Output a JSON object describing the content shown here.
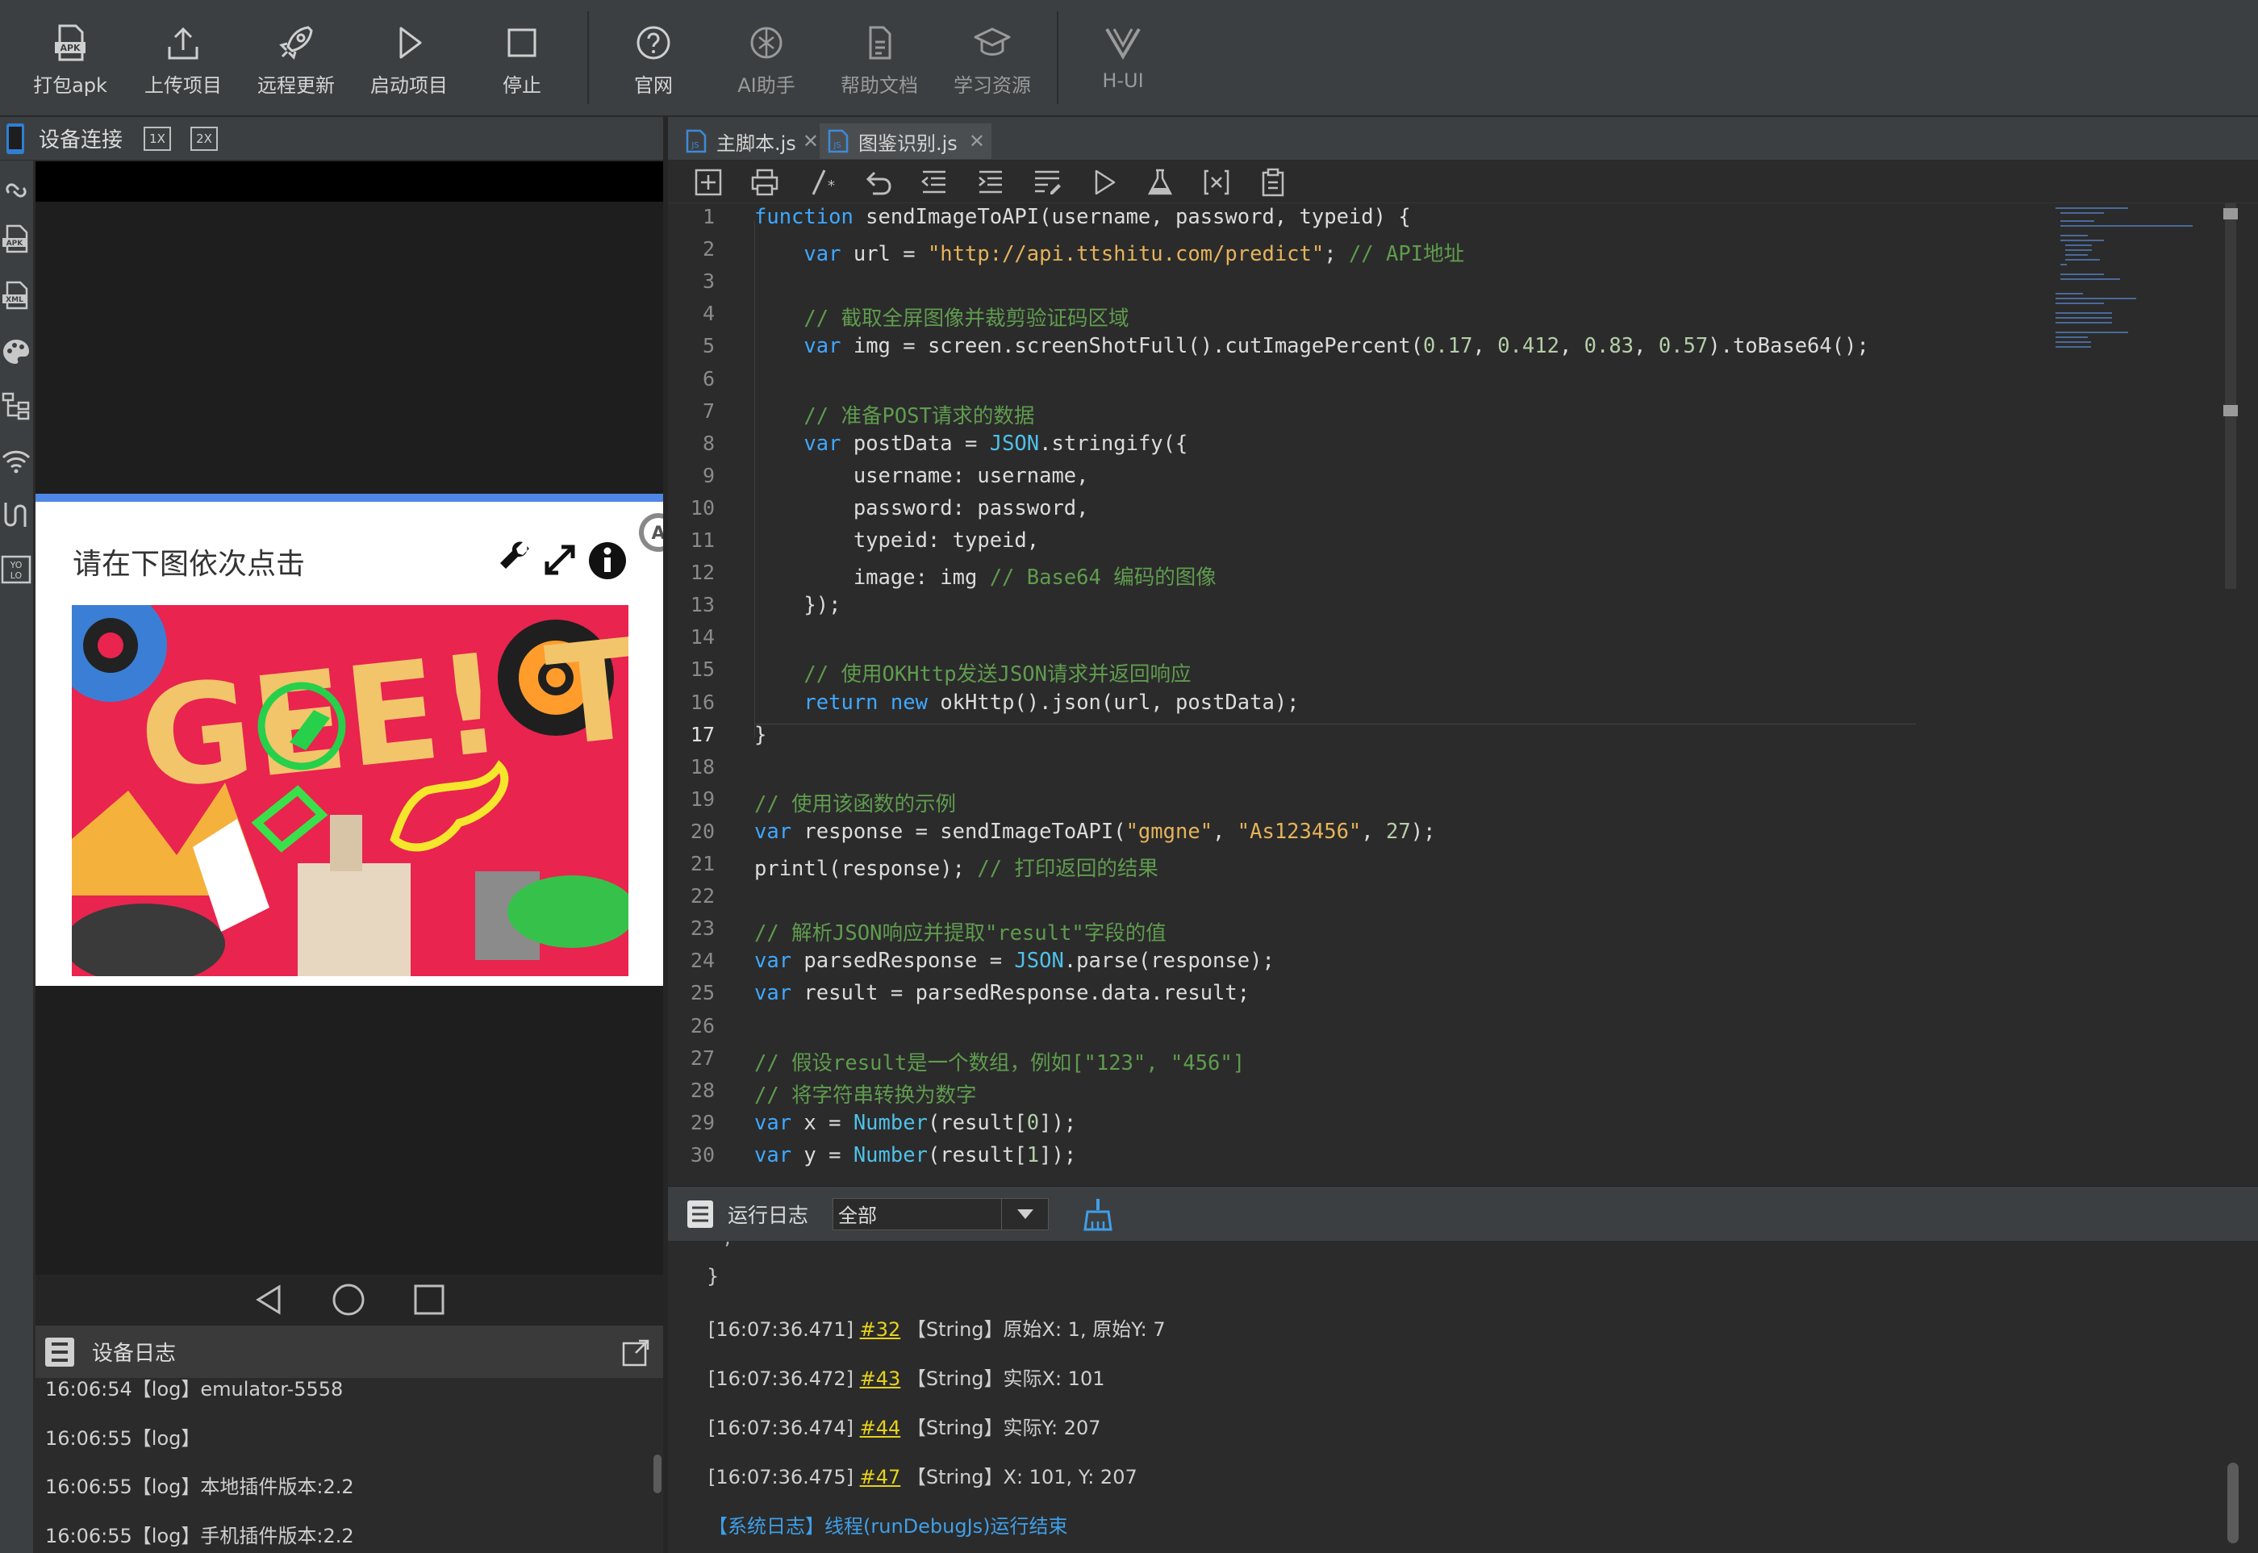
{
  "toolbar": {
    "items": [
      {
        "label": "打包apk",
        "icon": "apk-icon"
      },
      {
        "label": "上传项目",
        "icon": "upload-icon"
      },
      {
        "label": "远程更新",
        "icon": "rocket-icon"
      },
      {
        "label": "启动项目",
        "icon": "play-icon"
      },
      {
        "label": "停止",
        "icon": "stop-icon"
      },
      {
        "label": "官网",
        "icon": "help-circle-icon"
      },
      {
        "label": "AI助手",
        "icon": "ai-icon"
      },
      {
        "label": "帮助文档",
        "icon": "document-icon"
      },
      {
        "label": "学习资源",
        "icon": "graduation-cap-icon"
      },
      {
        "label": "H-UI",
        "icon": "hui-logo-icon"
      }
    ]
  },
  "device_panel": {
    "title": "设备连接",
    "zoom_1x": "1X",
    "zoom_2x": "2X",
    "captcha": {
      "prompt": "请在下图依次点击",
      "image_text": "GEE! TEST"
    },
    "device_log": {
      "title": "设备日志",
      "lines": [
        "16:06:54【log】emulator-5558",
        "16:06:55【log】",
        "16:06:55【log】本地插件版本:2.2",
        "16:06:55【log】手机插件版本:2.2"
      ]
    }
  },
  "tabs": [
    {
      "label": "主脚本.js"
    },
    {
      "label": "图鉴识别.js"
    }
  ],
  "editor": {
    "line_numbers": [
      "1",
      "2",
      "3",
      "4",
      "5",
      "6",
      "7",
      "8",
      "9",
      "10",
      "11",
      "12",
      "13",
      "14",
      "15",
      "16",
      "17",
      "18",
      "19",
      "20",
      "21",
      "22",
      "23",
      "24",
      "25",
      "26",
      "27",
      "28",
      "29",
      "30"
    ],
    "code": [
      "function sendImageToAPI(username, password, typeid) {",
      "    var url = \"http://api.ttshitu.com/predict\"; // API地址",
      "",
      "    // 截取全屏图像并裁剪验证码区域",
      "    var img = screen.screenShotFull().cutImagePercent(0.17, 0.412, 0.83, 0.57).toBase64();",
      "",
      "    // 准备POST请求的数据",
      "    var postData = JSON.stringify({",
      "        username: username,",
      "        password: password,",
      "        typeid: typeid,",
      "        image: img // Base64 编码的图像",
      "    });",
      "",
      "    // 使用OKHttp发送JSON请求并返回响应",
      "    return new okHttp().json(url, postData);",
      "}",
      "",
      "// 使用该函数的示例",
      "var response = sendImageToAPI(\"gmgne\", \"As123456\", 27);",
      "printl(response); // 打印返回的结果",
      "",
      "// 解析JSON响应并提取\"result\"字段的值",
      "var parsedResponse = JSON.parse(response);",
      "var result = parsedResponse.data.result;",
      "",
      "// 假设result是一个数组，例如[\"123\", \"456\"]",
      "// 将字符串转换为数字",
      "var x = Number(result[0]);",
      "var y = Number(result[1]);"
    ]
  },
  "log_panel": {
    "title": "运行日志",
    "filter": "全部",
    "brace": "}",
    "entries": [
      {
        "time": "[16:07:36.471]",
        "ref": "#32",
        "text": "【String】原始X: 1, 原始Y: 7"
      },
      {
        "time": "[16:07:36.472]",
        "ref": "#43",
        "text": "【String】实际X: 101"
      },
      {
        "time": "[16:07:36.474]",
        "ref": "#44",
        "text": "【String】实际Y: 207"
      },
      {
        "time": "[16:07:36.475]",
        "ref": "#47",
        "text": "【String】X: 101, Y: 207"
      }
    ],
    "system_line": "【系统日志】线程(runDebugJs)运行结束"
  },
  "colors": {
    "keyword": "#3fa8ff",
    "string": "#e5b35a",
    "comment": "#5f9c4e",
    "number": "#b5cea8",
    "link_ref": "#e7d21c",
    "system_log": "#3f9fe8"
  }
}
